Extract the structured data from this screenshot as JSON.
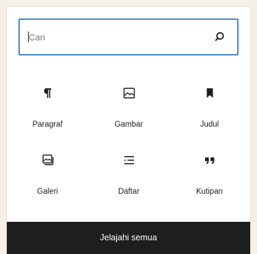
{
  "search": {
    "placeholder": "Cari",
    "value": ""
  },
  "blocks": [
    {
      "label": "Paragraf",
      "icon": "paragraph-icon"
    },
    {
      "label": "Gambar",
      "icon": "image-icon"
    },
    {
      "label": "Judul",
      "icon": "bookmark-icon"
    },
    {
      "label": "Galeri",
      "icon": "gallery-icon"
    },
    {
      "label": "Daftar",
      "icon": "list-icon"
    },
    {
      "label": "Kutipan",
      "icon": "quote-icon"
    }
  ],
  "footer": {
    "label": "Jelajahi semua"
  },
  "colors": {
    "accent": "#3f86c4",
    "footer_bg": "#1e1e1e",
    "page_bg": "#f5f0e5"
  }
}
